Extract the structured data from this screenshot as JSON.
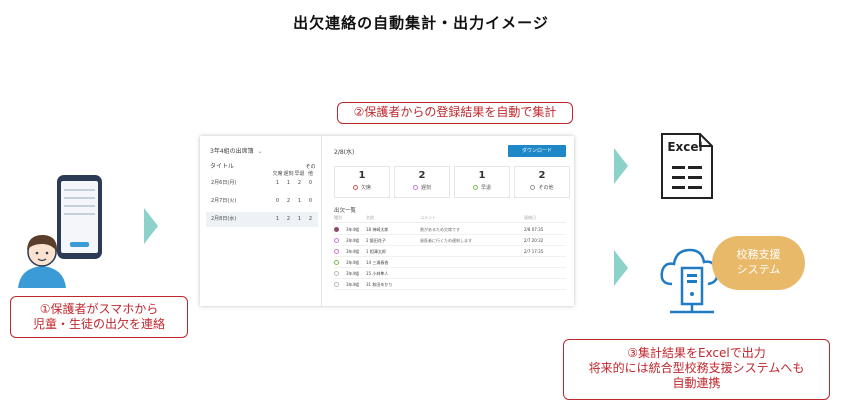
{
  "title": "出欠連絡の自動集計・出力イメージ",
  "callouts": {
    "auto": "②保護者からの登録結果を自動で集計",
    "phone": [
      "①保護者がスマホから",
      "児童・生徒の出欠を連絡"
    ],
    "excel": [
      "③集計結果をExcelで出力",
      "将来的には統合型校務支援システムへも",
      "自動連携"
    ]
  },
  "app": {
    "class_select": "3年4組の出席簿",
    "list_title": "タイトル",
    "count_headers": [
      "欠席",
      "遅刻",
      "早退",
      "その他"
    ],
    "dates": [
      {
        "label": "2月6日(月)",
        "counts": [
          "1",
          "1",
          "2",
          "0"
        ]
      },
      {
        "label": "2月7日(火)",
        "counts": [
          "0",
          "2",
          "1",
          "0"
        ]
      },
      {
        "label": "2月8日(水)",
        "counts": [
          "1",
          "2",
          "1",
          "2"
        ]
      }
    ],
    "current_date": "2/8(水)",
    "download": "ダウンロード",
    "summary": [
      {
        "num": "1",
        "label": "欠席",
        "color": "#d9534f"
      },
      {
        "num": "2",
        "label": "遅刻",
        "color": "#c77dd6"
      },
      {
        "num": "1",
        "label": "早退",
        "color": "#7bbf4a"
      },
      {
        "num": "2",
        "label": "その他",
        "color": "#999999"
      }
    ],
    "detail_title": "出欠一覧",
    "detail_headers": [
      "種別",
      "名前",
      "コメント",
      "連絡日"
    ],
    "rows": [
      {
        "grade": "3年4組",
        "name": "18 神崎太郎",
        "comment": "熱があるため欠席です",
        "time": "2/8 07:35",
        "color": "#8a4b6e"
      },
      {
        "grade": "3年4組",
        "name": "2 飯田花子",
        "comment": "歯医者に行くため遅刻します",
        "time": "2/7 20:32",
        "color": "#c77dd6"
      },
      {
        "grade": "3年4組",
        "name": "1 相澤太郎",
        "comment": "",
        "time": "2/7 17:35",
        "color": "#c77dd6"
      },
      {
        "grade": "3年4組",
        "name": "14 三浦春香",
        "comment": "",
        "time": "",
        "color": "#7bbf4a"
      },
      {
        "grade": "3年4組",
        "name": "15 小林隼人",
        "comment": "",
        "time": "",
        "color": "#999999"
      },
      {
        "grade": "3年4組",
        "name": "31 和田ゆかり",
        "comment": "",
        "time": "",
        "color": "#999999"
      }
    ]
  },
  "excel_label": "Excel",
  "badge": [
    "校務支援",
    "システム"
  ],
  "colors": {
    "accent_red": "#c0272d",
    "arrow": "#8cd1ca",
    "badge": "#e9b96a",
    "button": "#1e87c8"
  }
}
